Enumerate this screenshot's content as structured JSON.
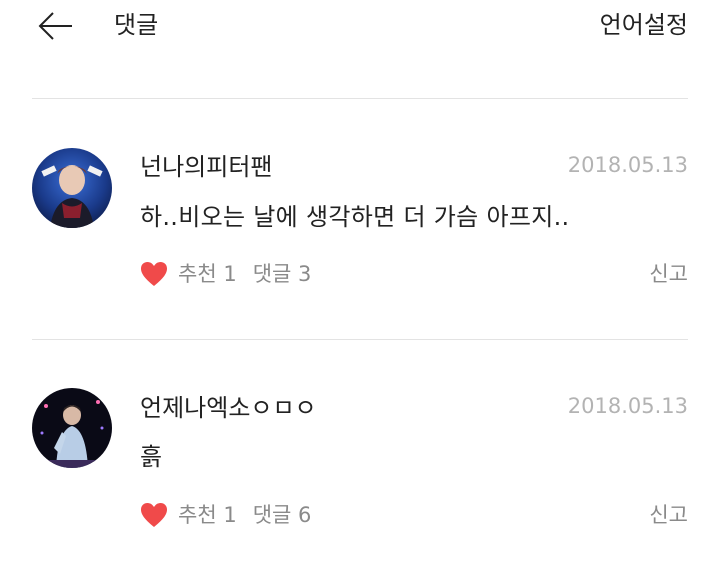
{
  "header": {
    "title": "댓글",
    "language_label": "언어설정",
    "back_icon": "arrow-left-icon"
  },
  "comments": [
    {
      "author": "넌나의피터팬",
      "date": "2018.05.13",
      "text": "하..비오는 날에 생각하면 더 가슴 아프지..",
      "like_label": "추천 1",
      "reply_label": "댓글 3",
      "report_label": "신고"
    },
    {
      "author": "언제나엑소ㅇㅁㅇ",
      "date": "2018.05.13",
      "text": "흙",
      "like_label": "추천 1",
      "reply_label": "댓글 6",
      "report_label": "신고"
    }
  ],
  "colors": {
    "heart": "#f04a4a",
    "date": "#b3b3b3",
    "secondary_text": "#8a8a8a",
    "divider": "#e3e3e3"
  }
}
